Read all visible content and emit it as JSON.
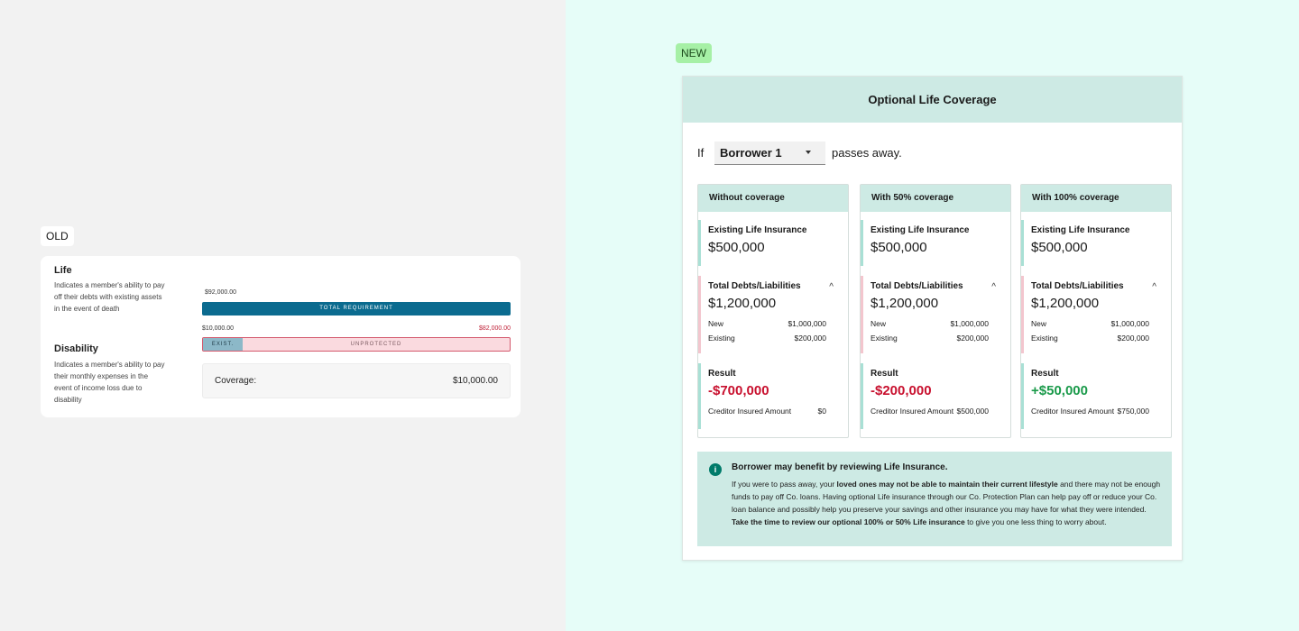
{
  "tags": {
    "old": "OLD",
    "new": "NEW"
  },
  "old": {
    "life_title": "Life",
    "life_desc": "Indicates a member's ability to pay off their debts with existing assets in the event of death",
    "disability_title": "Disability",
    "disability_desc": "Indicates a member's ability to pay their monthly expenses in the event of income loss due to disability",
    "total_amount": "$92,000.00",
    "total_label": "TOTAL REQUIREMENT",
    "existing_amount": "$10,000.00",
    "unprotected_amount": "$82,000.00",
    "exist_label": "EXIST.",
    "unprotected_label": "UNPROTECTED",
    "coverage_label": "Coverage:",
    "coverage_value": "$10,000.00"
  },
  "new": {
    "header": "Optional Life Coverage",
    "if_text": "If",
    "passes_text": "passes away.",
    "borrower_selected": "Borrower 1",
    "columns": [
      {
        "title": "Without coverage",
        "existing_label": "Existing Life Insurance",
        "existing_value": "$500,000",
        "debts_label": "Total Debts/Liabilities",
        "debts_value": "$1,200,000",
        "new_label": "New",
        "new_value": "$1,000,000",
        "existing_debt_label": "Existing",
        "existing_debt_value": "$200,000",
        "result_label": "Result",
        "result_value": "-$700,000",
        "creditor_label": "Creditor Insured Amount",
        "creditor_value": "$0"
      },
      {
        "title": "With 50% coverage",
        "existing_label": "Existing Life Insurance",
        "existing_value": "$500,000",
        "debts_label": "Total Debts/Liabilities",
        "debts_value": "$1,200,000",
        "new_label": "New",
        "new_value": "$1,000,000",
        "existing_debt_label": "Existing",
        "existing_debt_value": "$200,000",
        "result_label": "Result",
        "result_value": "-$200,000",
        "creditor_label": "Creditor Insured Amount",
        "creditor_value": "$500,000"
      },
      {
        "title": "With 100% coverage",
        "existing_label": "Existing Life Insurance",
        "existing_value": "$500,000",
        "debts_label": "Total Debts/Liabilities",
        "debts_value": "$1,200,000",
        "new_label": "New",
        "new_value": "$1,000,000",
        "existing_debt_label": "Existing",
        "existing_debt_value": "$200,000",
        "result_label": "Result",
        "result_value": "+$50,000",
        "creditor_label": "Creditor Insured Amount",
        "creditor_value": "$750,000"
      }
    ],
    "info": {
      "title": "Borrower may benefit by reviewing Life Insurance.",
      "p1": "If you were to pass away, your ",
      "b1": "loved ones may not be able to maintain their current lifestyle",
      "p2": " and there may not be enough funds to pay off Co. loans. Having optional Life insurance through our Co. Protection Plan can help pay off or reduce your Co. loan balance and possibly help you preserve your savings and other insurance you may have for what they were intended. ",
      "b2": "Take the time to review our optional 100% or 50% Life insurance",
      "p3": " to give you one less thing to worry about."
    }
  },
  "colors": {
    "header_teal": "#cdeae4",
    "negative": "#c8102e",
    "positive": "#1a9a4a",
    "total_bar": "#0b6b8f"
  }
}
